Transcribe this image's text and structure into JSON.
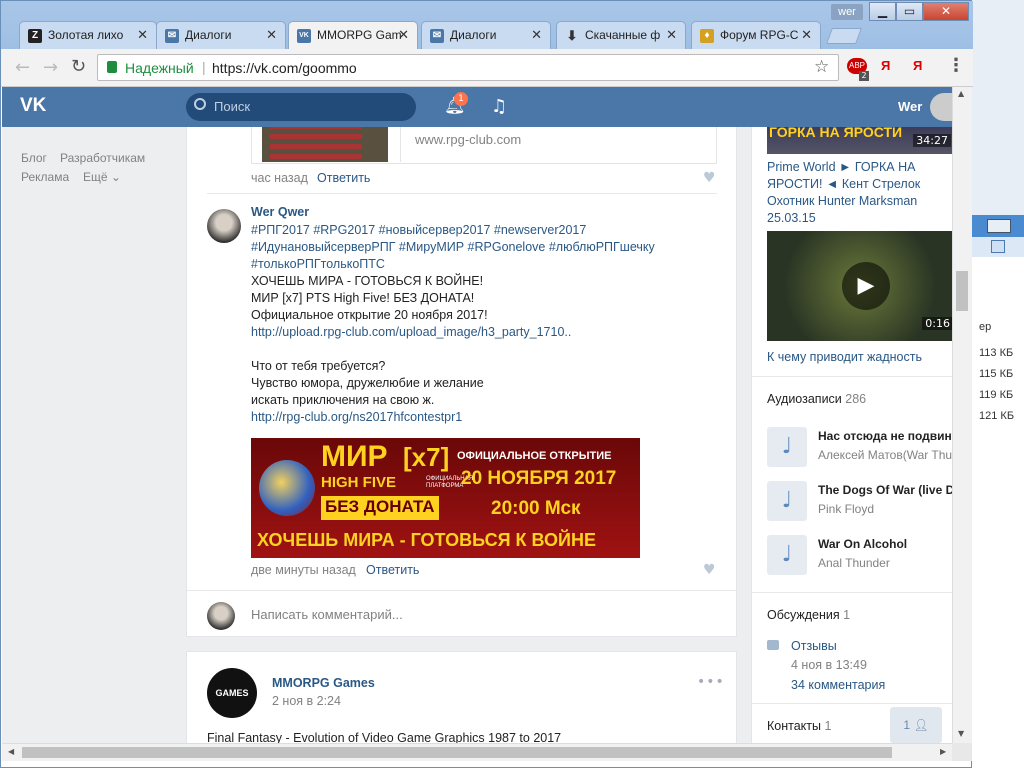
{
  "tabs": [
    {
      "label": "Золотая лихо",
      "icon": "Z"
    },
    {
      "label": "Диалоги",
      "icon": "✉"
    },
    {
      "label": "MMORPG Gam",
      "icon": "VK"
    },
    {
      "label": "Диалоги",
      "icon": "✉"
    },
    {
      "label": "Скачанные ф",
      "icon": "⬇"
    },
    {
      "label": "Форум RPG-С",
      "icon": "♦"
    }
  ],
  "window": {
    "user_badge": "wer"
  },
  "address": {
    "secure_label": "Надежный",
    "url": "https://vk.com/goommo"
  },
  "ext": {
    "e1": "ABP",
    "e1_count": "2",
    "e2": "Я",
    "e3": "Я"
  },
  "vk": {
    "search_placeholder": "Поиск",
    "notif_count": "1",
    "user_name": "Wer"
  },
  "left_links": {
    "blog": "Блог",
    "dev": "Разработчикам",
    "ads": "Реклама",
    "more": "Ещё"
  },
  "prev_post": {
    "link_domain": "www.rpg-club.com",
    "time": "час назад",
    "reply": "Ответить"
  },
  "post": {
    "author": "Wer Qwer",
    "hashtags": "#РПГ2017 #RPG2017 #новыйсервер2017 #newserver2017 #ИдунановыйсерверРПГ #МируМИР #RPGonelove #люблюРПГшечку #толькоРПГтолькоПТС",
    "line1": "ХОЧЕШЬ МИРА - ГОТОВЬСЯ К ВОЙНЕ!",
    "line2": "МИР [x7] PTS High Five! БЕЗ ДОНАТА!",
    "line3": "Официальное открытие 20 ноября 2017!",
    "url1": "http://upload.rpg-club.com/upload_image/h3_party_1710..",
    "line4": "Что от тебя требуется?",
    "line5": "Чувство юмора, дружелюбие и желание",
    "line6": "искать приключения на свою ж.",
    "url2": "http://rpg-club.org/ns2017hfcontestpr1",
    "time": "две минуты назад",
    "reply": "Ответить",
    "banner": {
      "mir": "МИР",
      "x7": "[x7]",
      "high_five": "HIGH FIVE",
      "official": "ОФИЦИАЛЬНАЯ ПЛАТФОРМА",
      "no_donate": "БЕЗ ДОНАТА",
      "opening": "ОФИЦИАЛЬНОЕ ОТКРЫТИЕ",
      "date": "20 НОЯБРЯ 2017",
      "hour": "20:00 Мск",
      "slogan": "ХОЧЕШЬ МИРА - ГОТОВЬСЯ К ВОЙНЕ"
    }
  },
  "comment_placeholder": "Написать комментарий...",
  "next_post": {
    "author": "MMORPG Games",
    "date": "2 ноя в 2:24",
    "text": "Final Fantasy - Evolution of Video Game Graphics 1987 to 2017",
    "avatar_text": "GAMES"
  },
  "right": {
    "video1": {
      "thumb_text": "ГОРКА НА ЯРОСТИ",
      "duration": "34:27",
      "title": "Prime World ► ГОРКА НА ЯРОСТИ! ◄ Кент Стрелок Охотник Hunter Marksman 25.03.15"
    },
    "video2": {
      "duration": "0:16",
      "title": "К чему приводит жадность"
    },
    "audio": {
      "header": "Аудиозаписи",
      "count": "286",
      "items": [
        {
          "title": "Нас отсюда не подвину",
          "artist": "Алексей Матов(War Thu"
        },
        {
          "title": "The Dogs Of War (live De",
          "artist": "Pink Floyd"
        },
        {
          "title": "War On Alcohol",
          "artist": "Anal Thunder"
        }
      ]
    },
    "discussions": {
      "header": "Обсуждения",
      "count": "1",
      "topic": "Отзывы",
      "date": "4 ноя в 13:49",
      "comments": "34 комментария"
    },
    "contacts": {
      "header": "Контакты",
      "count": "1"
    },
    "friends_btn": "1"
  },
  "bg_window": {
    "label": "ер",
    "sizes": [
      "113 КБ",
      "115 КБ",
      "119 КБ",
      "121 КБ"
    ]
  },
  "colors": {
    "vk_blue": "#4a76a8",
    "link": "#2a5885",
    "banner_red": "#8b0d0d",
    "banner_yellow": "#ffd21f"
  }
}
